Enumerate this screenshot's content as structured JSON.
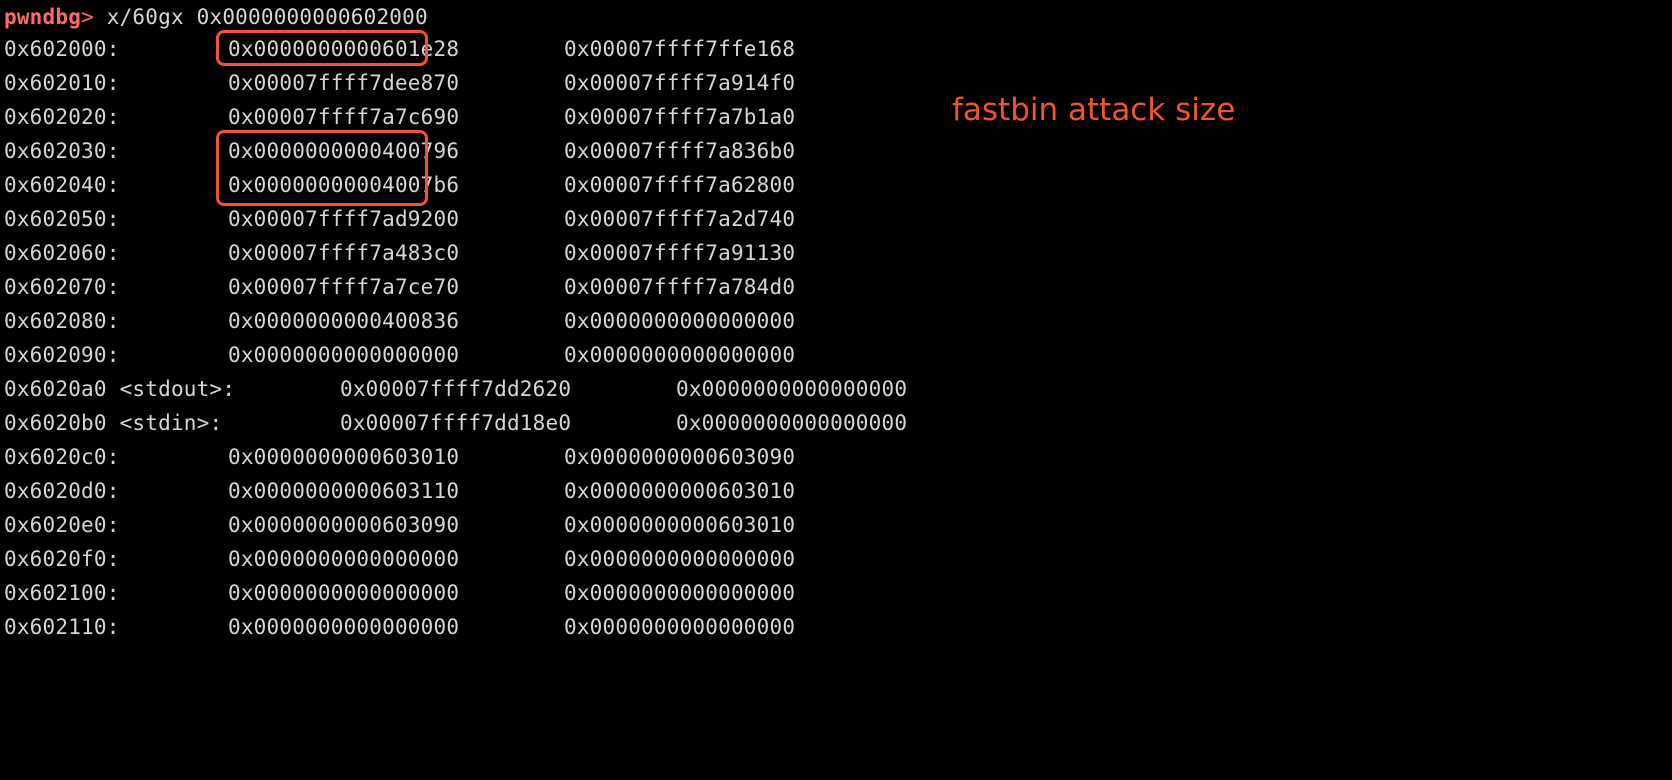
{
  "terminal": {
    "prompt": "pwndbg",
    "prompt_arrow": ">",
    "command": " x/60gx 0x0000000000602000",
    "rows": [
      {
        "addr": "0x602000:",
        "q1": "0x0000000000601e28",
        "q2": "0x00007ffff7ffe168"
      },
      {
        "addr": "0x602010:",
        "q1": "0x00007ffff7dee870",
        "q2": "0x00007ffff7a914f0"
      },
      {
        "addr": "0x602020:",
        "q1": "0x00007ffff7a7c690",
        "q2": "0x00007ffff7a7b1a0"
      },
      {
        "addr": "0x602030:",
        "q1": "0x0000000000400796",
        "q2": "0x00007ffff7a836b0"
      },
      {
        "addr": "0x602040:",
        "q1": "0x00000000004007b6",
        "q2": "0x00007ffff7a62800"
      },
      {
        "addr": "0x602050:",
        "q1": "0x00007ffff7ad9200",
        "q2": "0x00007ffff7a2d740"
      },
      {
        "addr": "0x602060:",
        "q1": "0x00007ffff7a483c0",
        "q2": "0x00007ffff7a91130"
      },
      {
        "addr": "0x602070:",
        "q1": "0x00007ffff7a7ce70",
        "q2": "0x00007ffff7a784d0"
      },
      {
        "addr": "0x602080:",
        "q1": "0x0000000000400836",
        "q2": "0x0000000000000000"
      },
      {
        "addr": "0x602090:",
        "q1": "0x0000000000000000",
        "q2": "0x0000000000000000"
      },
      {
        "addr": "0x6020a0 <stdout>:",
        "q1": "0x00007ffff7dd2620",
        "q2": "0x0000000000000000",
        "symbol": true
      },
      {
        "addr": "0x6020b0 <stdin>:",
        "q1": "0x00007ffff7dd18e0",
        "q2": "0x0000000000000000",
        "symbol": true
      },
      {
        "addr": "0x6020c0:",
        "q1": "0x0000000000603010",
        "q2": "0x0000000000603090"
      },
      {
        "addr": "0x6020d0:",
        "q1": "0x0000000000603110",
        "q2": "0x0000000000603010"
      },
      {
        "addr": "0x6020e0:",
        "q1": "0x0000000000603090",
        "q2": "0x0000000000603010"
      },
      {
        "addr": "0x6020f0:",
        "q1": "0x0000000000000000",
        "q2": "0x0000000000000000"
      },
      {
        "addr": "0x602100:",
        "q1": "0x0000000000000000",
        "q2": "0x0000000000000000"
      },
      {
        "addr": "0x602110:",
        "q1": "0x0000000000000000",
        "q2": "0x0000000000000000"
      }
    ]
  },
  "annotation": {
    "text": "fastbin attack size"
  },
  "colors": {
    "background": "#000000",
    "text": "#d6d6d6",
    "prompt": "#ff6a6a",
    "highlight": "#f2542d"
  }
}
